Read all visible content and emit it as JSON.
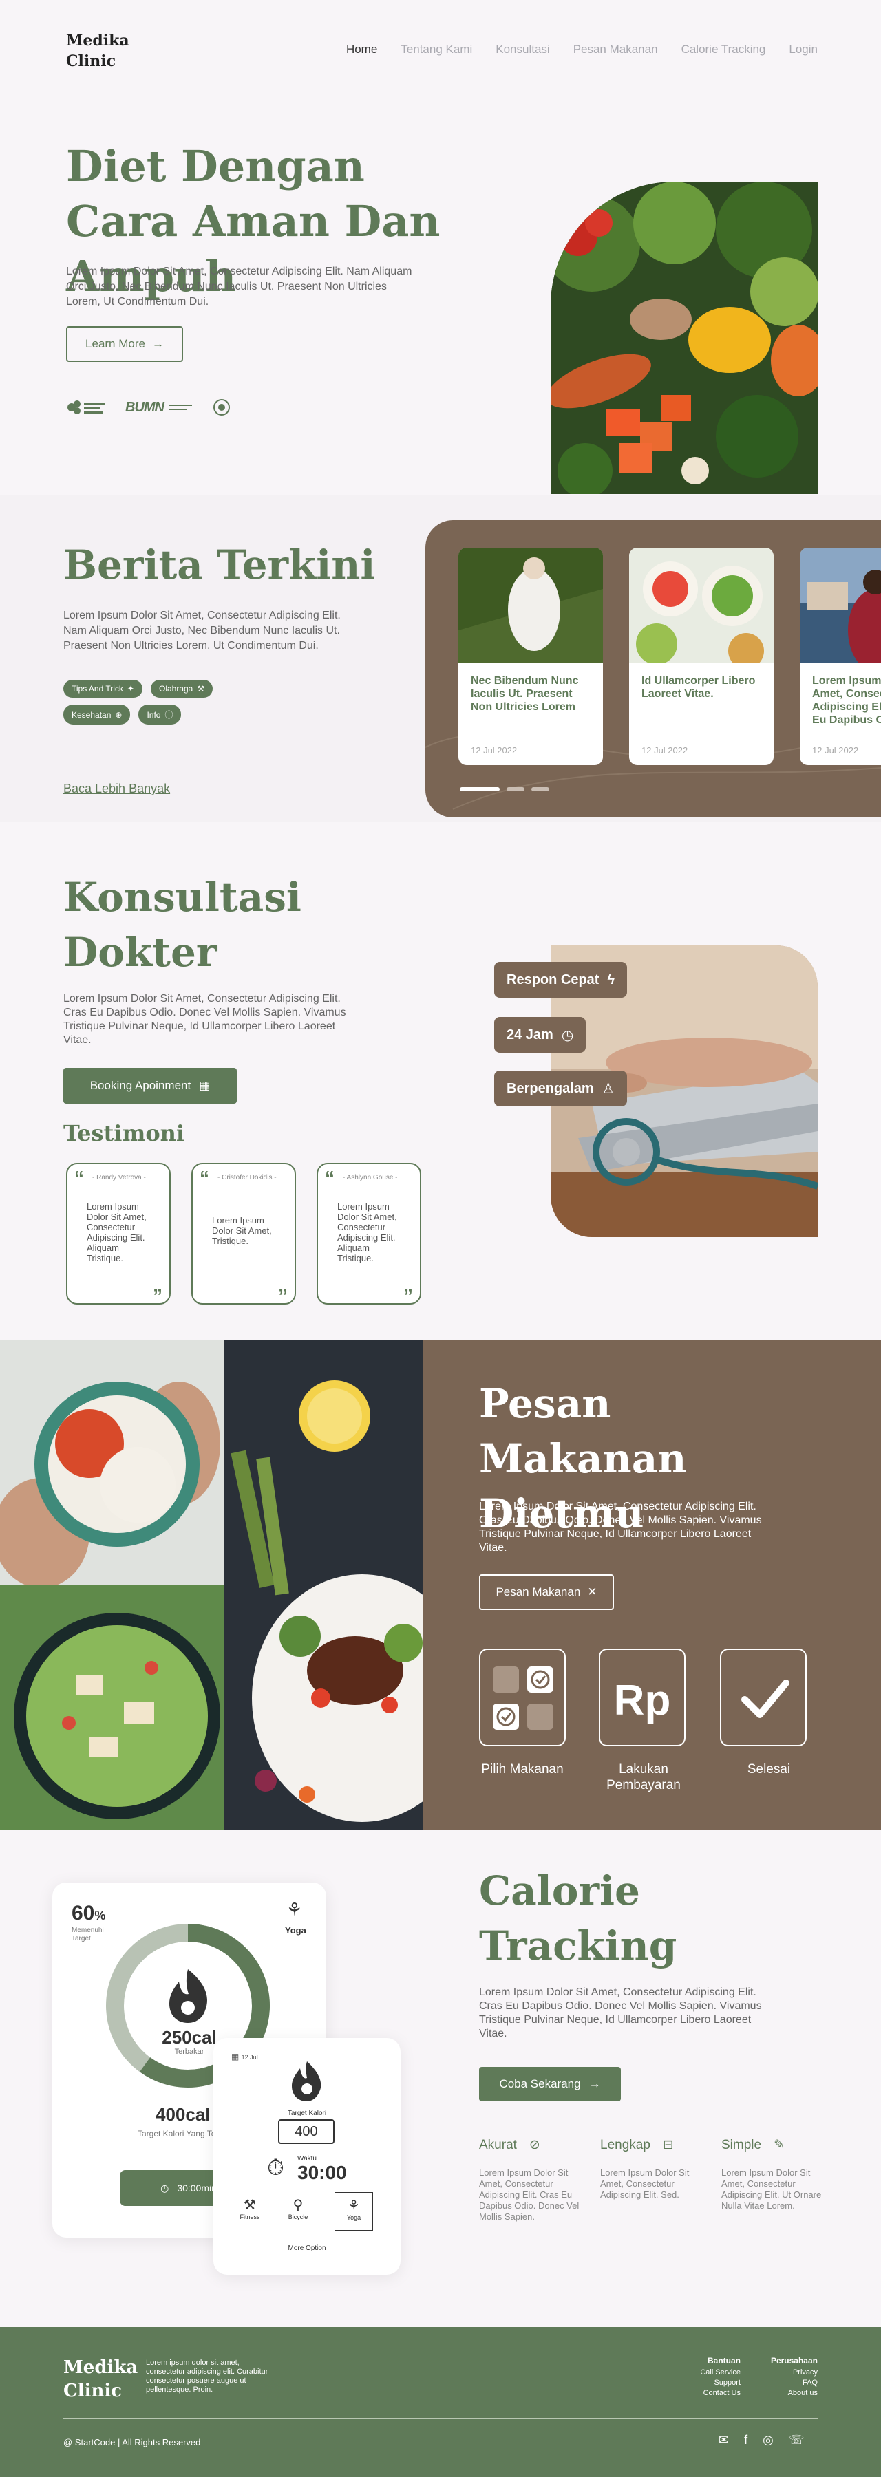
{
  "nav": {
    "logo_line1": "Medika",
    "logo_line2": "Clinic",
    "links": [
      "Home",
      "Tentang Kami",
      "Konsultasi",
      "Pesan Makanan",
      "Calorie Tracking",
      "Login"
    ]
  },
  "hero": {
    "title": "Diet Dengan Cara Aman Dan Ampuh",
    "text": "Lorem Ipsum Dolor Sit Amet, Consectetur Adipiscing Elit. Nam Aliquam Orci Justo, Nec Bibendum Nunc Iaculis Ut. Praesent Non Ultricies Lorem, Ut Condimentum Dui.",
    "button": "Learn More",
    "partner_bumn": "BUMN"
  },
  "berita": {
    "title": "Berita Terkini",
    "text": "Lorem Ipsum Dolor Sit Amet, Consectetur Adipiscing Elit. Nam Aliquam Orci Justo, Nec Bibendum Nunc Iaculis Ut. Praesent Non Ultricies Lorem, Ut Condimentum Dui.",
    "tags": [
      "Tips And Trick",
      "Olahraga",
      "Kesehatan",
      "Info"
    ],
    "link": "Baca Lebih Banyak",
    "cards": [
      {
        "title": "Nec Bibendum Nunc Iaculis Ut. Praesent Non Ultricies Lorem",
        "date": "12 Jul 2022"
      },
      {
        "title": "Id Ullamcorper Libero Laoreet Vitae.",
        "date": "12 Jul 2022"
      },
      {
        "title": "Lorem Ipsum Dolor Sit Amet, Consectetur Adipiscing Elit. Cras Eu Dapibus Odio.",
        "date": "12 Jul 2022"
      }
    ]
  },
  "konsultasi": {
    "title": "Konsultasi Dokter",
    "text": "Lorem Ipsum Dolor Sit Amet, Consectetur Adipiscing Elit. Cras Eu Dapibus Odio. Donec Vel Mollis Sapien. Vivamus Tristique Pulvinar Neque, Id Ullamcorper Libero Laoreet Vitae.",
    "button": "Booking Apoinment",
    "badges": [
      "Respon Cepat",
      "24 Jam",
      "Berpengalam"
    ],
    "testimoni_title": "Testimoni",
    "testimonials": [
      {
        "name": "- Randy Vetrova -",
        "text": "Lorem Ipsum Dolor Sit Amet, Consectetur Adipiscing Elit. Aliquam Tristique."
      },
      {
        "name": "- Cristofer Dokidis -",
        "text": "Lorem Ipsum Dolor Sit Amet, Tristique."
      },
      {
        "name": "- Ashlynn Gouse -",
        "text": "Lorem Ipsum Dolor Sit Amet, Consectetur Adipiscing Elit. Aliquam Tristique."
      }
    ]
  },
  "pesan": {
    "title": "Pesan Makanan Dietmu",
    "text": "Lorem Ipsum Dolor Sit Amet, Consectetur Adipiscing Elit. Cras Eu Dapibus Odio. Donec Vel Mollis Sapien. Vivamus Tristique Pulvinar Neque, Id Ullamcorper Libero Laoreet Vitae.",
    "button": "Pesan Makanan",
    "rp": "Rp",
    "steps": [
      "Pilih Makanan",
      "Lakukan Pembayaran",
      "Selesai"
    ]
  },
  "calorie": {
    "title": "Calorie Tracking",
    "text": "Lorem Ipsum Dolor Sit Amet, Consectetur Adipiscing Elit. Cras Eu Dapibus Odio. Donec Vel Mollis Sapien. Vivamus Tristique Pulvinar Neque, Id Ullamcorper Libero Laoreet Vitae.",
    "button": "Coba Sekarang",
    "features": [
      {
        "title": "Akurat",
        "text": "Lorem Ipsum Dolor Sit Amet, Consectetur Adipiscing Elit. Cras Eu Dapibus Odio. Donec Vel Mollis Sapien."
      },
      {
        "title": "Lengkap",
        "text": "Lorem Ipsum Dolor Sit Amet, Consectetur Adipiscing Elit. Sed."
      },
      {
        "title": "Simple",
        "text": "Lorem Ipsum Dolor Sit Amet, Consectetur Adipiscing Elit. Ut Ornare Nulla Vitae Lorem."
      }
    ],
    "phone1": {
      "percent": "60",
      "percent_unit": "%",
      "percent_label": "Memenuhi Target",
      "activity": "Yoga",
      "cal_value": "250cal",
      "cal_label": "Terbakar",
      "target_value": "400cal",
      "target_label": "Target Kalori Yang Te",
      "timer": "30:00min",
      "progress": 0.6
    },
    "phone2": {
      "date": "12 Jul",
      "target_label": "Target Kalori",
      "target_value": "400",
      "time_label": "Waktu",
      "time_value": "30:00",
      "options": [
        "Fitness",
        "Bicycle",
        "Yoga"
      ],
      "more": "More Option"
    }
  },
  "footer": {
    "logo_line1": "Medika",
    "logo_line2": "Clinic",
    "text": "Lorem ipsum dolor sit amet, consectetur adipiscing elit. Curabitur consectetur posuere augue ut pellentesque. Proin.",
    "col1_title": "Bantuan",
    "col1": [
      "Call Service",
      "Support",
      "Contact Us"
    ],
    "col2_title": "Perusahaan",
    "col2": [
      "Privacy",
      "FAQ",
      "About us"
    ],
    "copyright": "@ StartCode | All Rights Reserved"
  }
}
